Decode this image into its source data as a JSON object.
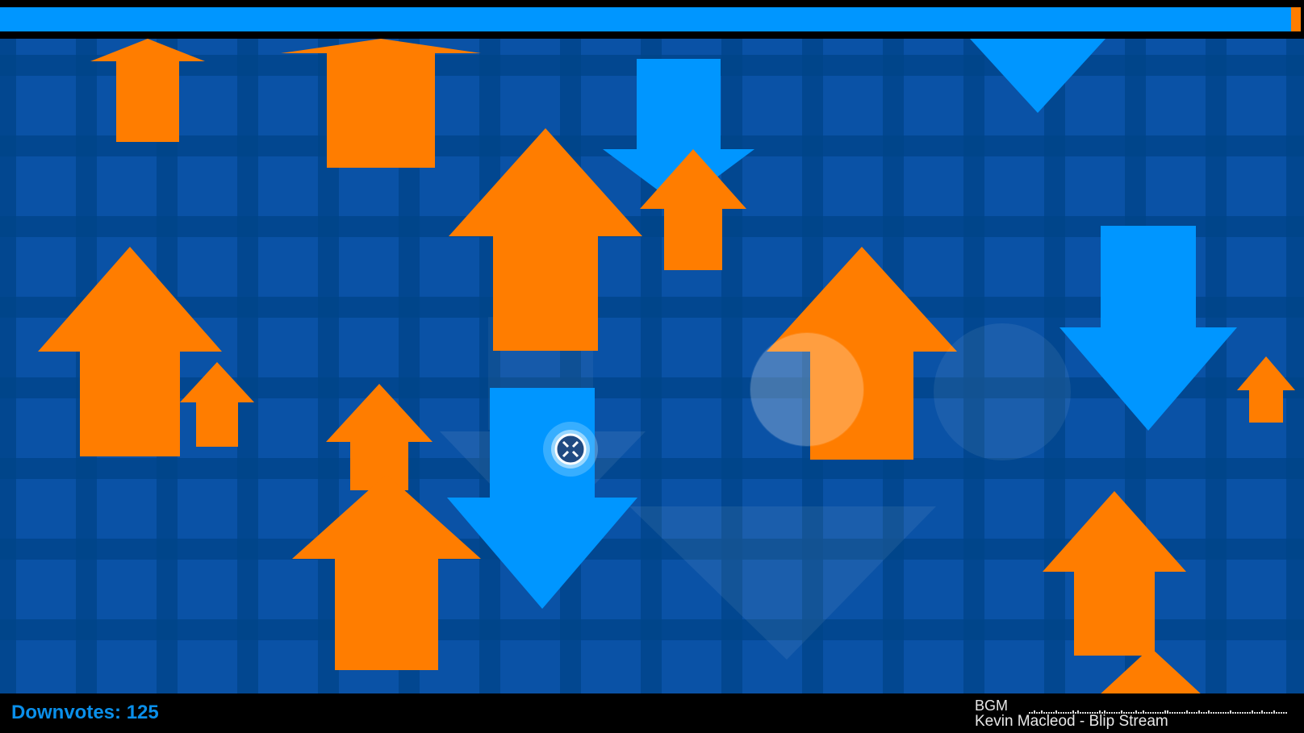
{
  "hud": {
    "score_label": "Downvotes:",
    "score_value": "125",
    "bgm_label": "BGM",
    "bgm_track": "Kevin Macleod - Blip Stream"
  },
  "level_progress": 0.99,
  "colors": {
    "background": "#0a52a6",
    "grid_line": "#004488",
    "upvote_arrow": "#ff7d00",
    "downvote_arrow": "#0096ff",
    "hud_score": "#0a8fea"
  },
  "icons": {
    "player": "crosshair-cursor-icon",
    "upvote": "up-arrow-icon",
    "downvote": "down-arrow-icon"
  }
}
